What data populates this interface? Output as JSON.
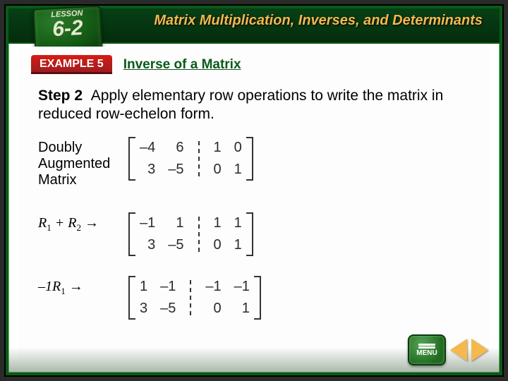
{
  "lesson": {
    "label": "LESSON",
    "number": "6-2"
  },
  "chapter_title": "Matrix Multiplication, Inverses, and Determinants",
  "example": {
    "tab": "EXAMPLE 5",
    "subtitle": "Inverse of a Matrix"
  },
  "step": {
    "label": "Step 2",
    "text": "Apply elementary row operations to write the matrix in reduced row-echelon form."
  },
  "rows": [
    {
      "label_html": "Doubly Augmented Matrix",
      "matrix": {
        "left": [
          [
            "–4",
            "6"
          ],
          [
            "3",
            "–5"
          ]
        ],
        "right": [
          [
            "1",
            "0"
          ],
          [
            "0",
            "1"
          ]
        ]
      }
    },
    {
      "label_html": "R1 + R2 →",
      "op": {
        "type": "add",
        "a": "R1",
        "b": "R2"
      },
      "matrix": {
        "left": [
          [
            "–1",
            "1"
          ],
          [
            "3",
            "–5"
          ]
        ],
        "right": [
          [
            "1",
            "1"
          ],
          [
            "0",
            "1"
          ]
        ]
      }
    },
    {
      "label_html": "–1R1 →",
      "op": {
        "type": "scale",
        "k": "-1",
        "row": "R1"
      },
      "matrix": {
        "left": [
          [
            "1",
            "–1"
          ],
          [
            "3",
            "–5"
          ]
        ],
        "right": [
          [
            "–1",
            "–1"
          ],
          [
            "0",
            "1"
          ]
        ]
      }
    }
  ],
  "nav": {
    "menu": "MENU"
  }
}
